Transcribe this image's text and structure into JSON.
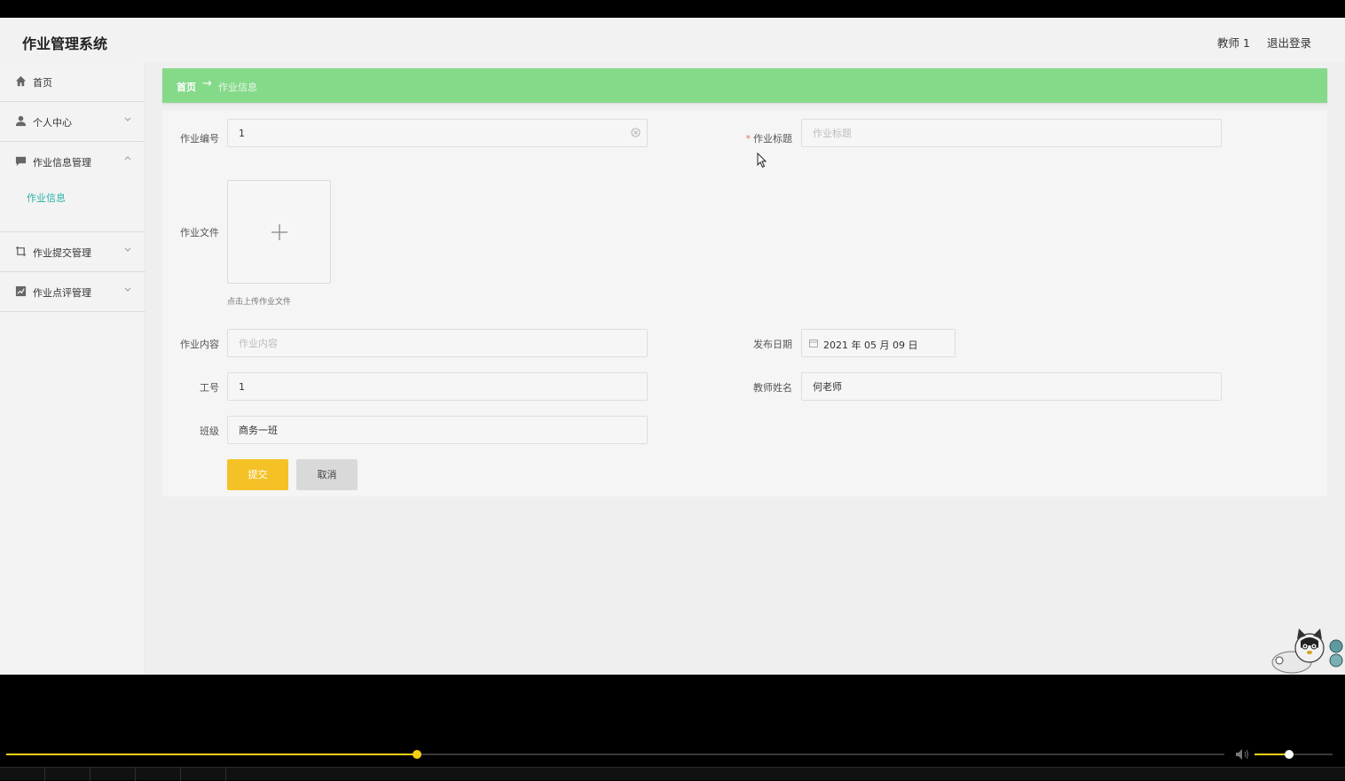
{
  "header": {
    "title": "作业管理系统",
    "user": "教师 1",
    "logout": "退出登录"
  },
  "sidebar": {
    "items": [
      {
        "label": "首页",
        "icon": "home-icon"
      },
      {
        "label": "个人中心",
        "icon": "user-icon"
      },
      {
        "label": "作业信息管理",
        "icon": "message-icon",
        "expanded": true
      },
      {
        "label": "作业提交管理",
        "icon": "crop-icon"
      },
      {
        "label": "作业点评管理",
        "icon": "chart-icon"
      }
    ],
    "submenu": {
      "label": "作业信息"
    }
  },
  "breadcrumb": {
    "home": "首页",
    "separator": "→",
    "current": "作业信息"
  },
  "form": {
    "homework_no": {
      "label": "作业编号",
      "value": "1"
    },
    "homework_title": {
      "label": "作业标题",
      "required_mark": "*",
      "placeholder": "作业标题"
    },
    "homework_file": {
      "label": "作业文件",
      "tip": "点击上传作业文件"
    },
    "homework_content": {
      "label": "作业内容",
      "placeholder": "作业内容"
    },
    "publish_date": {
      "label": "发布日期",
      "value": "2021 年 05 月 09 日"
    },
    "staff_no": {
      "label": "工号",
      "value": "1"
    },
    "teacher_name": {
      "label": "教师姓名",
      "value": "何老师"
    },
    "class": {
      "label": "班级",
      "value": "商务一班"
    },
    "submit_label": "提交",
    "cancel_label": "取消"
  },
  "player": {
    "progress": 0.337,
    "volume": 0.44
  },
  "colors": {
    "accent_green": "#85da8a",
    "submit_yellow": "#f4c227",
    "submenu_teal": "#2bb3a6",
    "player_yellow": "#f2d016"
  }
}
